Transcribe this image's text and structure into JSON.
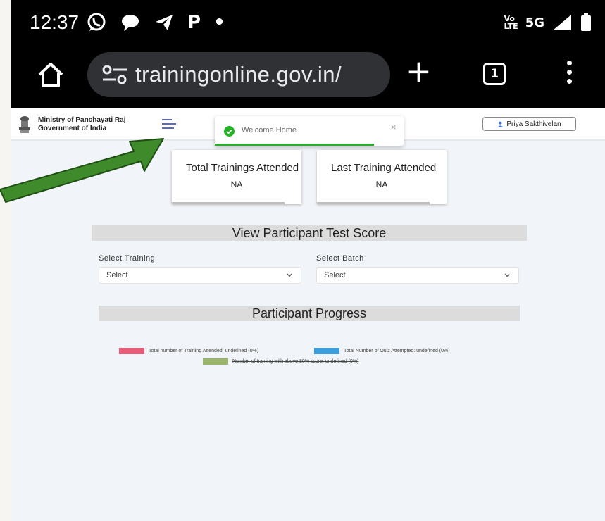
{
  "status_bar": {
    "time": "12:37",
    "icons": [
      "whatsapp-icon",
      "chat-icon",
      "telegram-icon",
      "P",
      "•"
    ],
    "volte_line1": "Vo",
    "volte_line2": "LTE",
    "network": "5G"
  },
  "browser": {
    "url": "trainingonline.gov.in/",
    "tab_count": "1"
  },
  "header": {
    "ministry_line1": "Ministry of Panchayati Raj",
    "ministry_line2": "Government of India",
    "user_name": "Priya Sakthivelan"
  },
  "toast": {
    "message": "Welcome Home",
    "close": "×",
    "color": "#25b325"
  },
  "stats": [
    {
      "label": "Total Trainings Attended",
      "value": "NA"
    },
    {
      "label": "Last Training Attended",
      "value": "NA"
    }
  ],
  "test_score": {
    "title": "View Participant Test Score",
    "training_label": "Select Training",
    "training_value": "Select",
    "batch_label": "Select Batch",
    "batch_value": "Select"
  },
  "progress": {
    "title": "Participant Progress",
    "legend": [
      {
        "text": "Total number of Training Attended: undefined (0%)",
        "color": "#e85c7a"
      },
      {
        "text": "Total Number of Quiz Attempted: undefined (0%)",
        "color": "#3b9ddd"
      },
      {
        "text": "Number of training with above 80% score: undefined (0%)",
        "color": "#9bb56b"
      }
    ]
  },
  "annotation_arrow_color": "#3f8a2a"
}
